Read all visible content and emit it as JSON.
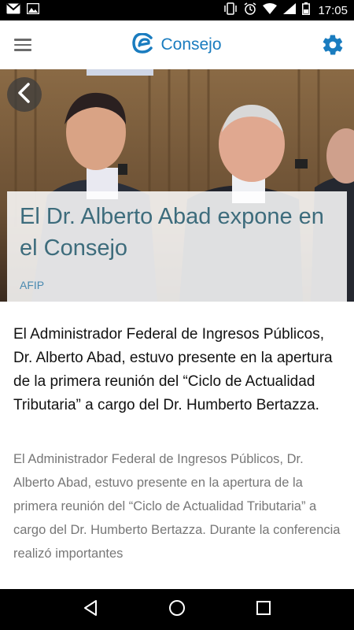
{
  "status_bar": {
    "time": "17:05",
    "left_icons": [
      "gmail-icon",
      "image-icon"
    ],
    "right_icons": [
      "vibrate-icon",
      "alarm-icon",
      "wifi-icon",
      "signal-icon",
      "battery-icon"
    ]
  },
  "app_bar": {
    "title": "Consejo",
    "menu_icon": "hamburger-menu-icon",
    "settings_icon": "gear-icon",
    "brand_color": "#1a7cbf"
  },
  "article": {
    "title": "El Dr. Alberto Abad expone en el Consejo",
    "source": "AFIP",
    "lead": "El Administrador Federal de Ingresos Públicos, Dr. Alberto Abad, estuvo presente en la apertura de la primera reunión del “Ciclo de Actualidad Tributaria” a cargo del Dr. Humberto Bertazza.",
    "body": "El Administrador Federal de Ingresos Públicos, Dr. Alberto Abad, estuvo presente en la apertura de la primera reunión del “Ciclo de Actualidad Tributaria” a cargo del Dr. Humberto Bertazza. Durante la conferencia realizó importantes"
  },
  "nav_bar": {
    "buttons": [
      "back-triangle-icon",
      "home-circle-icon",
      "recents-square-icon"
    ]
  }
}
